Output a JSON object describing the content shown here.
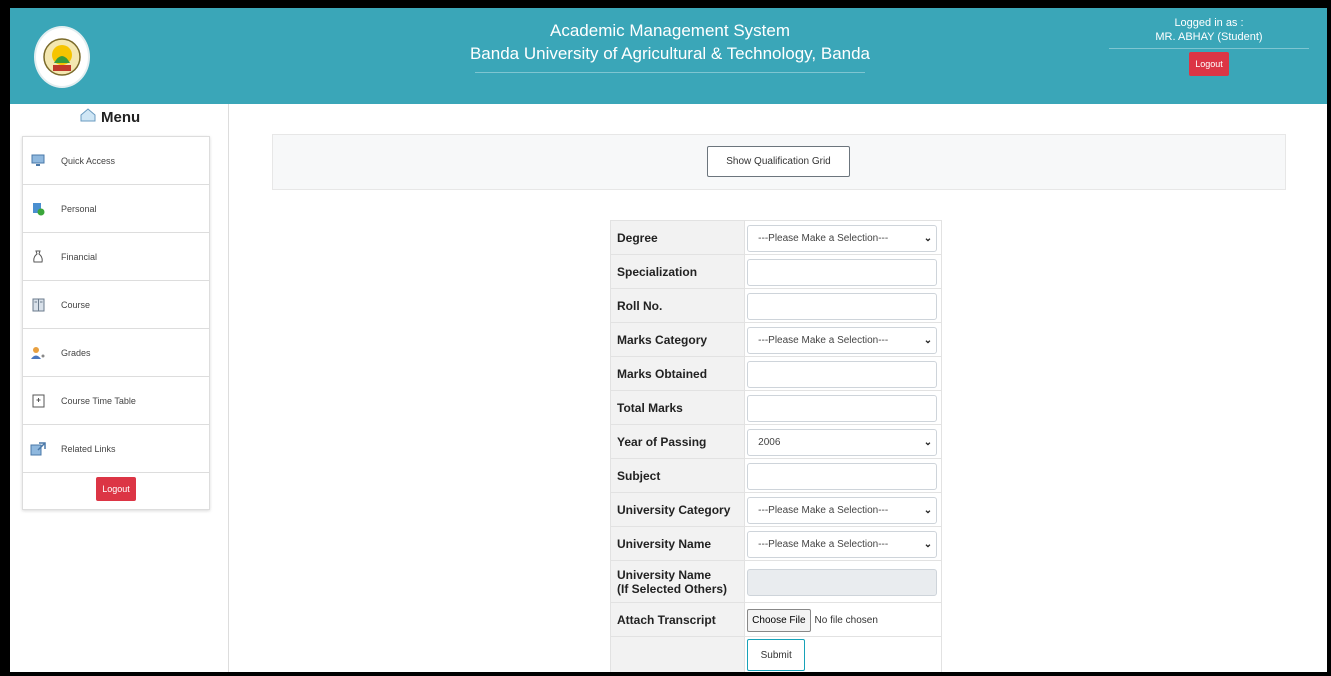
{
  "header": {
    "title": "Academic Management System",
    "subtitle": "Banda University of Agricultural & Technology, Banda",
    "logged_in_label": "Logged in as :",
    "user": "MR. ABHAY (Student)",
    "logout": "Logout",
    "brand_color": "#3aa6b8"
  },
  "sidebar": {
    "title": "Menu",
    "items": [
      {
        "label": "Quick Access",
        "icon": "monitor-icon"
      },
      {
        "label": "Personal",
        "icon": "user-add-icon"
      },
      {
        "label": "Financial",
        "icon": "money-bag-icon"
      },
      {
        "label": "Course",
        "icon": "book-icon"
      },
      {
        "label": "Grades",
        "icon": "student-icon"
      },
      {
        "label": "Course Time Table",
        "icon": "calendar-icon"
      },
      {
        "label": "Related Links",
        "icon": "link-icon"
      }
    ],
    "logout": "Logout"
  },
  "main": {
    "grid_button": "Show Qualification Grid",
    "form": {
      "degree": {
        "label": "Degree",
        "value": "---Please Make a Selection---"
      },
      "specialization": {
        "label": "Specialization",
        "value": ""
      },
      "roll_no": {
        "label": "Roll No.",
        "value": ""
      },
      "marks_category": {
        "label": "Marks Category",
        "value": "---Please Make a Selection---"
      },
      "marks_obtained": {
        "label": "Marks Obtained",
        "value": ""
      },
      "total_marks": {
        "label": "Total Marks",
        "value": ""
      },
      "year_of_passing": {
        "label": "Year of Passing",
        "value": "2006"
      },
      "subject": {
        "label": "Subject",
        "value": ""
      },
      "university_category": {
        "label": "University Category",
        "value": "---Please Make a Selection---"
      },
      "university_name": {
        "label": "University Name",
        "value": "---Please Make a Selection---"
      },
      "university_name_other": {
        "label_line1": "University Name",
        "label_line2": "(If Selected Others)",
        "value": ""
      },
      "attach_transcript": {
        "label": "Attach Transcript",
        "button": "Choose File",
        "status": "No file chosen"
      },
      "submit": "Submit"
    }
  }
}
